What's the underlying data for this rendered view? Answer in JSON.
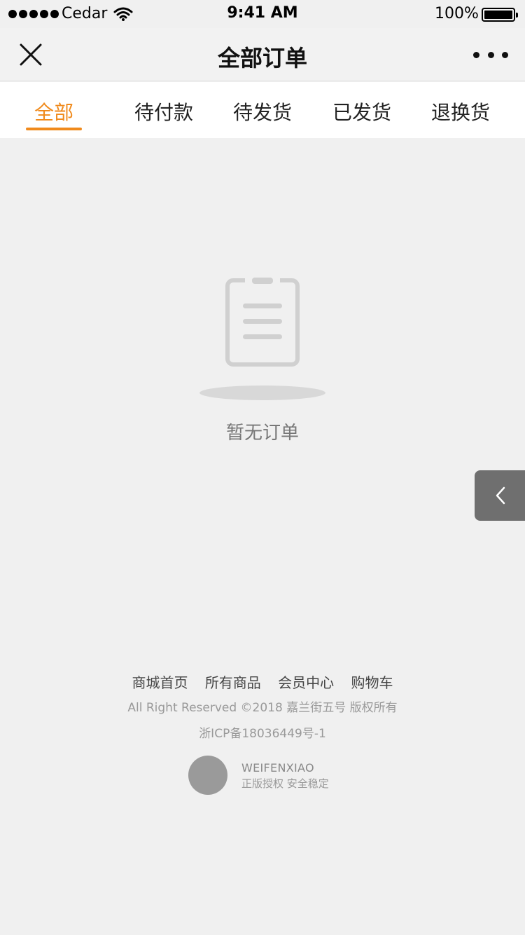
{
  "status_bar": {
    "carrier": "Cedar",
    "time": "9:41 AM",
    "battery": "100%"
  },
  "nav": {
    "title": "全部订单"
  },
  "tabs": [
    {
      "label": "全部",
      "active": true
    },
    {
      "label": "待付款",
      "active": false
    },
    {
      "label": "待发货",
      "active": false
    },
    {
      "label": "已发货",
      "active": false
    },
    {
      "label": "退换货",
      "active": false
    }
  ],
  "empty_state": {
    "message": "暂无订单",
    "icon": "clipboard-icon"
  },
  "footer": {
    "links": [
      "商城首页",
      "所有商品",
      "会员中心",
      "购物车"
    ],
    "copyright": "All Right Reserved ©2018 嘉兰街五号 版权所有",
    "icp": "浙ICP备18036449号-1",
    "brand_name": "WEIFENXIAO",
    "brand_tagline": "正版授权 安全稳定"
  },
  "colors": {
    "accent": "#f08a1c",
    "background": "#f0f0f0",
    "float_button": "#6f6f6f"
  }
}
